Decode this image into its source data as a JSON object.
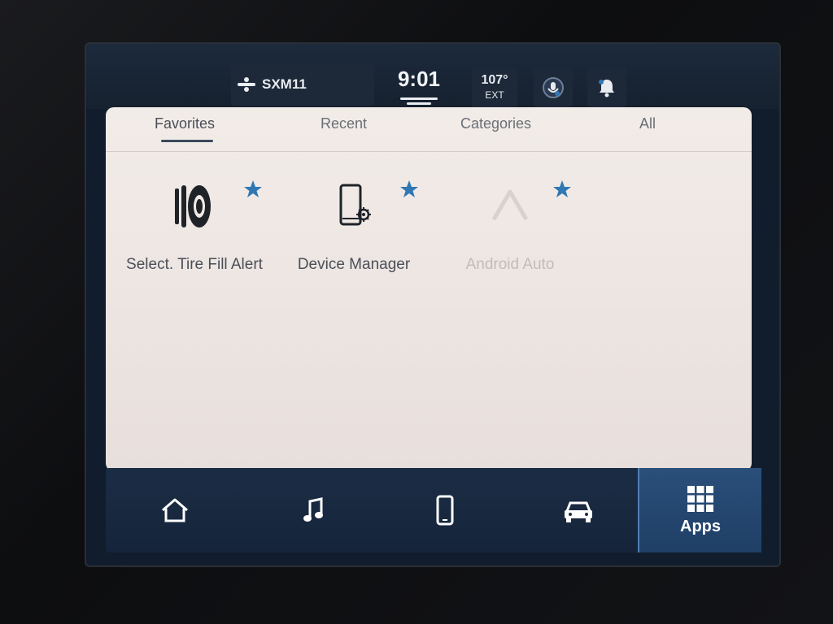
{
  "status_bar": {
    "radio_source": "SXM11",
    "clock": "9:01",
    "temperature": "107°",
    "temperature_unit": "EXT"
  },
  "tabs": [
    {
      "label": "Favorites",
      "active": true
    },
    {
      "label": "Recent",
      "active": false
    },
    {
      "label": "Categories",
      "active": false
    },
    {
      "label": "All",
      "active": false
    }
  ],
  "apps": [
    {
      "label": "Select. Tire Fill Alert",
      "icon": "tire-icon",
      "favorite": true,
      "enabled": true
    },
    {
      "label": "Device Manager",
      "icon": "phone-settings-icon",
      "favorite": true,
      "enabled": true
    },
    {
      "label": "Android Auto",
      "icon": "android-auto-icon",
      "favorite": true,
      "enabled": false
    }
  ],
  "nav": {
    "items": [
      {
        "icon": "home-icon"
      },
      {
        "icon": "music-icon"
      },
      {
        "icon": "phone-icon"
      },
      {
        "icon": "car-icon"
      },
      {
        "icon": "apps-grid-icon",
        "label": "Apps",
        "active": true
      }
    ]
  },
  "colors": {
    "accent": "#2f78b5",
    "star": "#2f78b5",
    "nav_bg": "#1b2d45",
    "panel_bg": "#f0e9e6"
  }
}
